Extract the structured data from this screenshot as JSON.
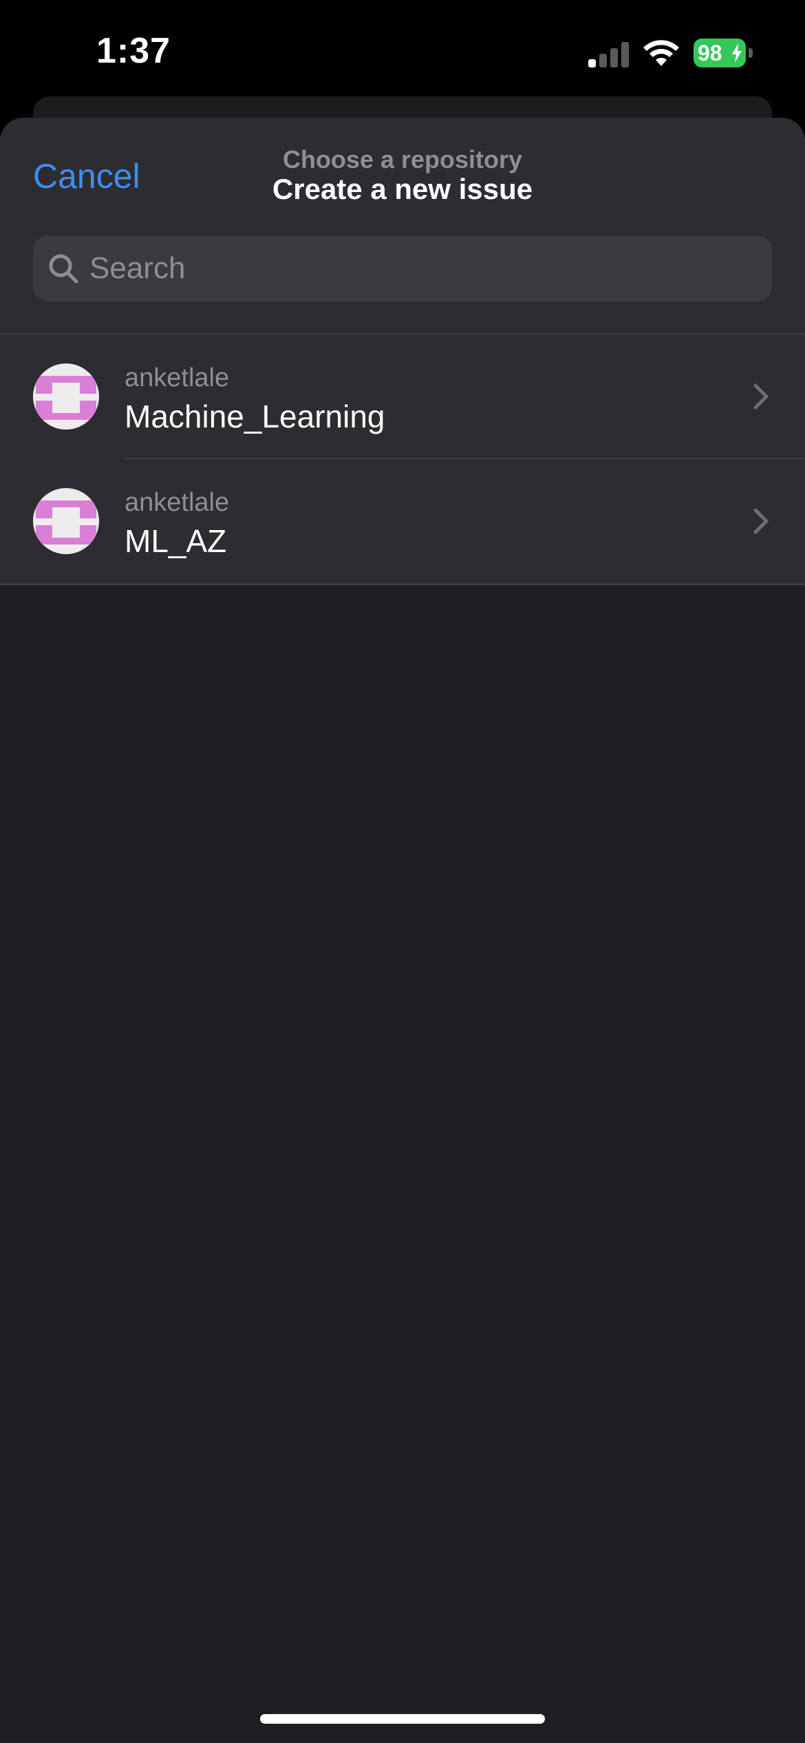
{
  "status_bar": {
    "time": "1:37",
    "battery": "98"
  },
  "nav": {
    "cancel_label": "Cancel",
    "subtitle": "Choose a repository",
    "title": "Create a new issue"
  },
  "search": {
    "placeholder": "Search",
    "value": ""
  },
  "repositories": [
    {
      "owner": "anketlale",
      "name": "Machine_Learning"
    },
    {
      "owner": "anketlale",
      "name": "ML_AZ"
    }
  ],
  "colors": {
    "accent": "#3f8ef0",
    "battery": "#34c759",
    "avatar_pattern": "#d97fd6",
    "background": "#1f1f23",
    "cell": "#2c2c31"
  },
  "icons": {
    "search": "search-icon",
    "chevron": "chevron-right-icon",
    "signal": "cellular-signal-icon",
    "wifi": "wifi-icon",
    "battery": "battery-charging-icon"
  }
}
